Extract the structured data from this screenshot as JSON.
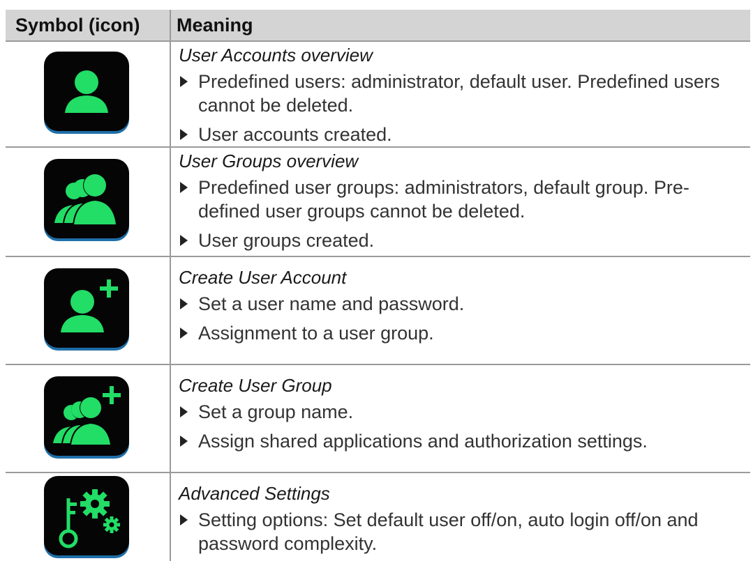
{
  "table": {
    "header": {
      "symbol": "Symbol (icon)",
      "meaning": "Meaning"
    },
    "rows": [
      {
        "icon": "user-icon",
        "title": "User Accounts overview",
        "bullets": [
          "Predefined users: administrator, default user. Predefined users cannot be deleted.",
          "User accounts created."
        ]
      },
      {
        "icon": "user-group-icon",
        "title": "User Groups overview",
        "bullets": [
          "Predefined user groups: administrators, default group. Pre-defined user groups cannot be deleted.",
          "User groups created."
        ]
      },
      {
        "icon": "add-user-icon",
        "title": "Create User Account",
        "bullets": [
          "Set a user name and password.",
          "Assignment to a user group."
        ]
      },
      {
        "icon": "add-group-icon",
        "title": "Create User Group",
        "bullets": [
          "Set a group name.",
          "Assign shared applications and authorization settings."
        ]
      },
      {
        "icon": "key-gears-icon",
        "title": "Advanced Settings",
        "bullets": [
          "Setting options: Set default user off/on, auto login off/on and password complexity."
        ]
      }
    ]
  },
  "colors": {
    "icon_green": "#22dd66",
    "icon_bg": "#000000",
    "icon_rim": "#1f6fa8",
    "header_bg": "#d4d4d4"
  }
}
